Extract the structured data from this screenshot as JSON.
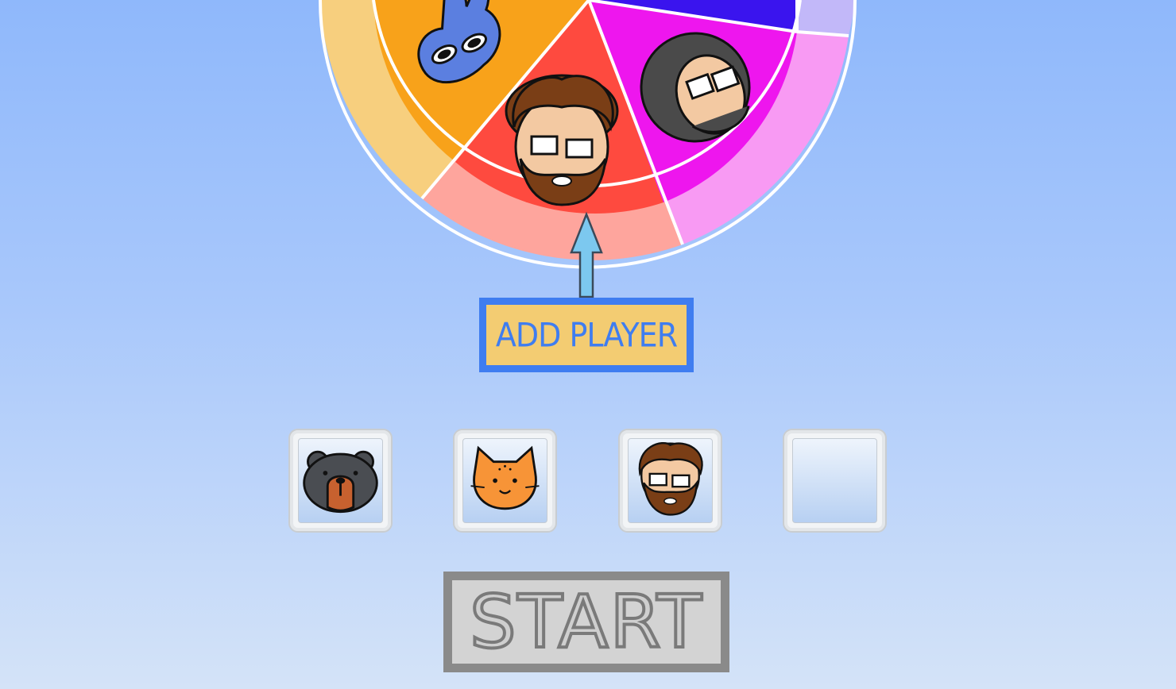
{
  "wheel": {
    "segments": [
      {
        "name": "player-orange",
        "color": "#f8a21a",
        "rim_color": "#f7cf7e",
        "icon": "rabbit-mask-icon"
      },
      {
        "name": "player-red",
        "color": "#fe4a3f",
        "rim_color": "#fea59d",
        "icon": "bearded-man-avatar-icon"
      },
      {
        "name": "player-magenta",
        "color": "#ee16ee",
        "rim_color": "#f89af3",
        "icon": "curly-hair-man-avatar-icon"
      },
      {
        "name": "player-blue",
        "color": "#3a14ee",
        "rim_color": "#c2b8f9",
        "icon": ""
      }
    ],
    "pointer_icon": "up-arrow-icon",
    "pointer_color": "#7cc8ef"
  },
  "add_player": {
    "label": "ADD PLAYER",
    "bg_color": "#f3cc72",
    "border_color": "#3f7df0"
  },
  "player_slots": [
    {
      "icon": "bear-avatar-icon",
      "filled": true
    },
    {
      "icon": "cat-avatar-icon",
      "filled": true
    },
    {
      "icon": "bearded-man-avatar-icon",
      "filled": true
    },
    {
      "icon": "",
      "filled": false
    }
  ],
  "start": {
    "label": "START",
    "enabled": false
  }
}
